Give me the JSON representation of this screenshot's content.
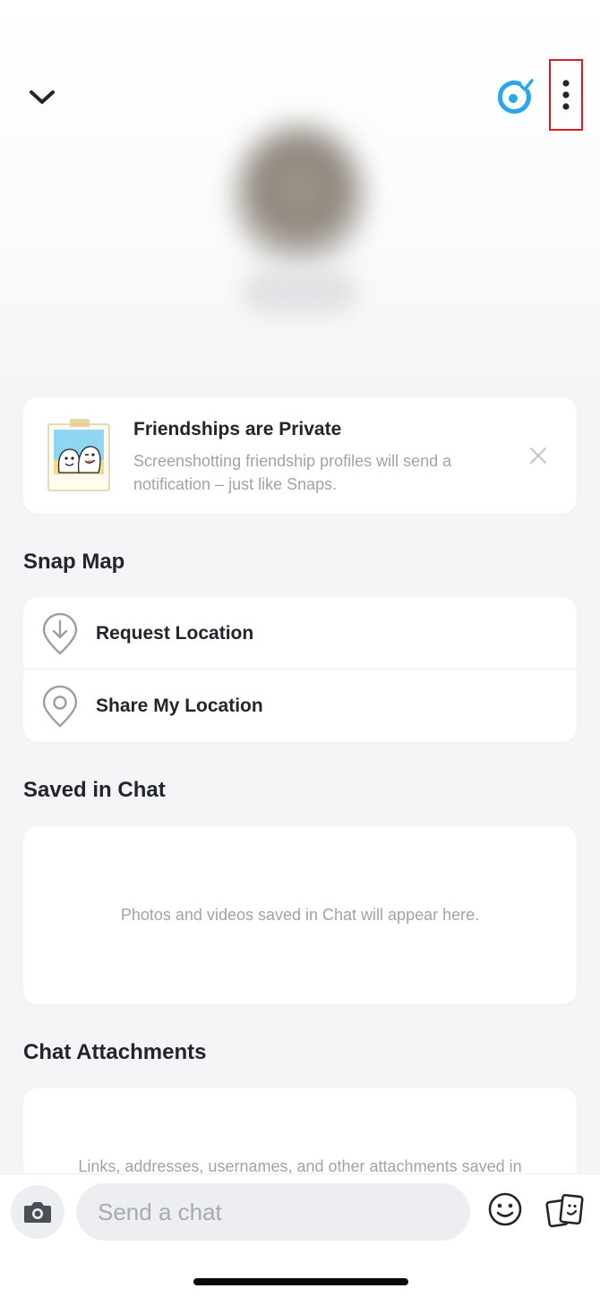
{
  "header": {
    "back_icon": "chevron-down-icon",
    "snapstar_icon": "snapstar-icon",
    "more_icon": "more-vertical-icon",
    "accent_color": "#29a7ea",
    "highlight_color": "#d51f26"
  },
  "notice": {
    "title": "Friendships are Private",
    "body": "Screenshotting friendship profiles will send a notification – just like Snaps.",
    "close_icon": "close-icon"
  },
  "snap_map": {
    "title": "Snap Map",
    "items": [
      {
        "label": "Request Location",
        "icon": "location-request-icon"
      },
      {
        "label": "Share My Location",
        "icon": "location-pin-icon"
      }
    ]
  },
  "saved_in_chat": {
    "title": "Saved in Chat",
    "empty_text": "Photos and videos saved in Chat will appear here."
  },
  "chat_attachments": {
    "title": "Chat Attachments",
    "empty_text": "Links, addresses, usernames, and other attachments saved in"
  },
  "composer": {
    "placeholder": "Send a chat",
    "camera_icon": "camera-icon",
    "emoji_icon": "emoji-icon",
    "sticker_icon": "sticker-icon"
  }
}
